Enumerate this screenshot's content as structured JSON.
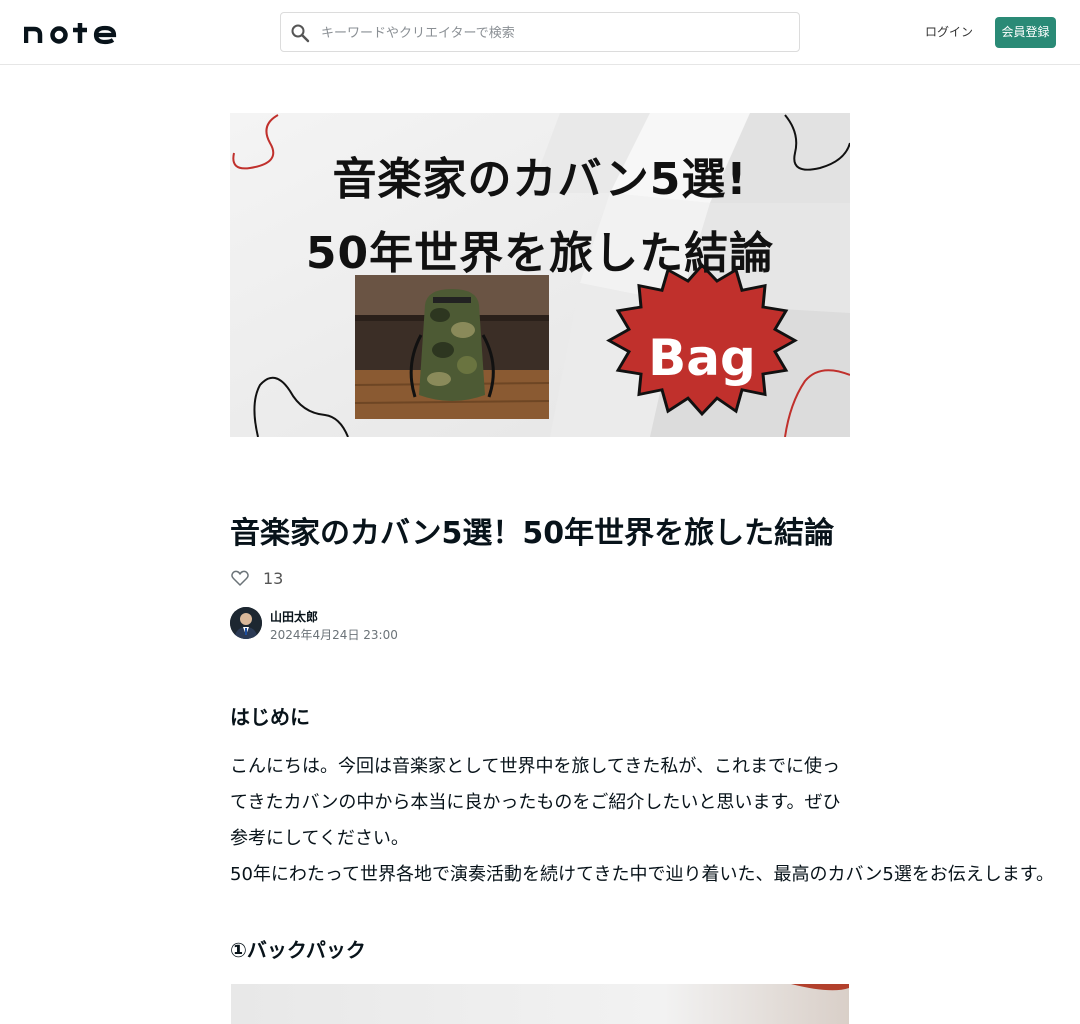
{
  "header": {
    "logo_text": "note",
    "search_placeholder": "キーワードやクリエイターで検索",
    "login_label": "ログイン",
    "signup_label": "会員登録"
  },
  "hero": {
    "line1": "音楽家のカバン5選!",
    "line2": "50年世界を旅した結論",
    "badge_text": "Bag"
  },
  "article": {
    "title": "音楽家のカバン5選！50年世界を旅した結論",
    "like_count": "13",
    "author": "山田太郎",
    "date": "2024年4月24日 23:00",
    "intro_heading": "はじめに",
    "paragraph1": "こんにちは。今回は音楽家として世界中を旅してきた私が、これまでに使ってきたカバンの中から本当に良かったものをご紹介したいと思います。ぜひ参考にしてください。",
    "paragraph2": "50年にわたって世界各地で演奏活動を続けてきた中で辿り着いた、最高のカバン5選をお伝えします。",
    "item1_heading": "①バックパック"
  },
  "colors": {
    "brand_green": "#2a8a76",
    "badge_red": "#c0302c",
    "accent_red_line": "#c0302c"
  }
}
